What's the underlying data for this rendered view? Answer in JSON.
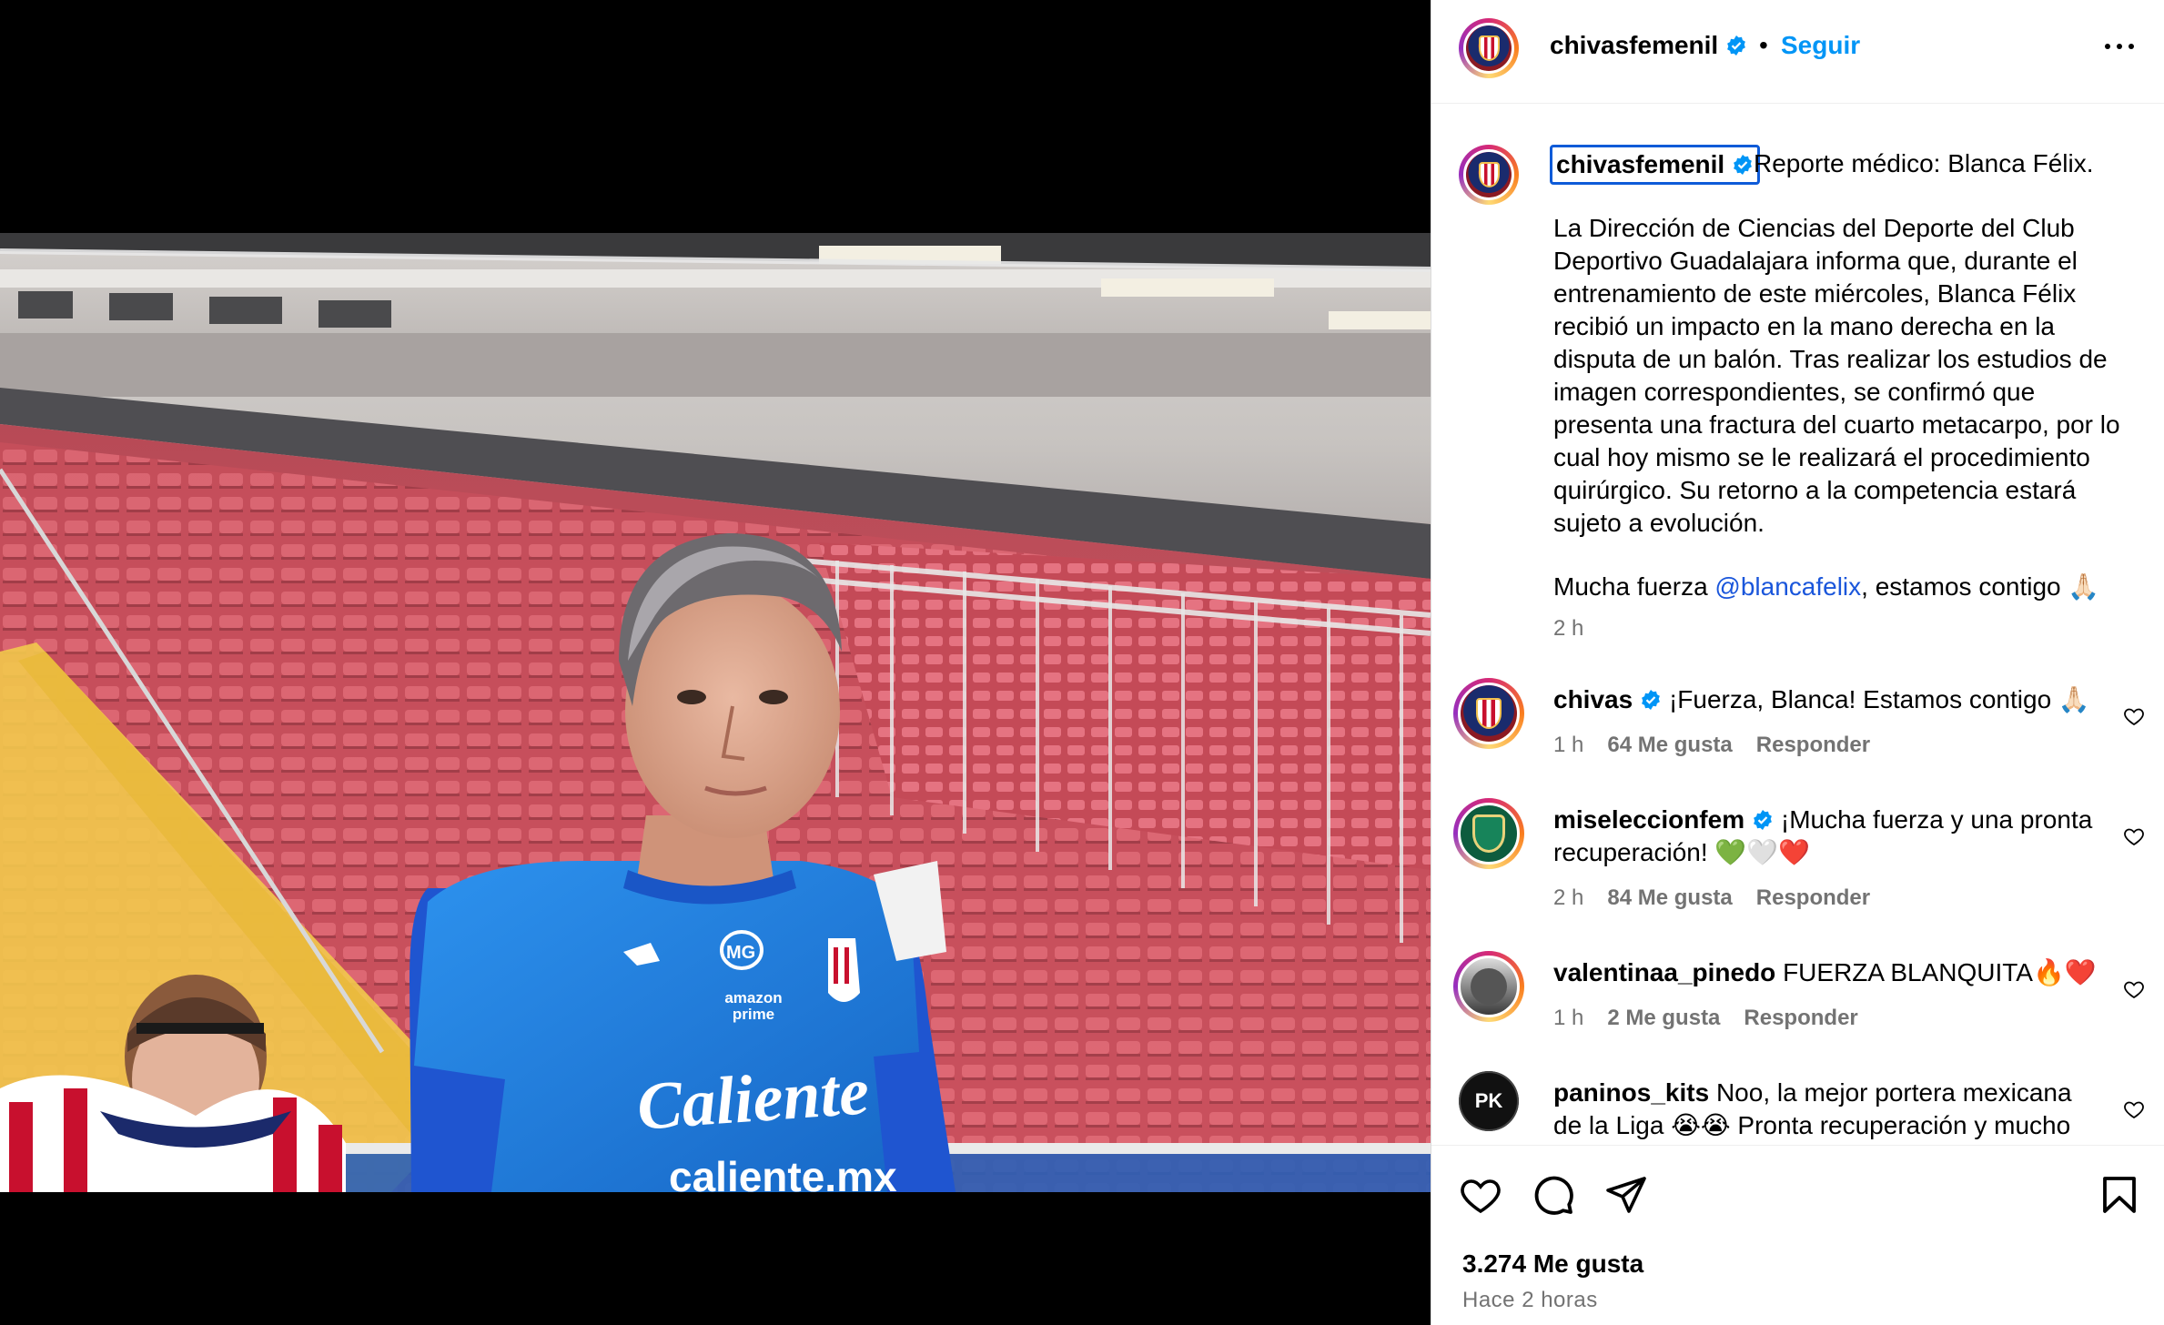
{
  "post": {
    "username": "chivasfemenil",
    "follow_label": "Seguir",
    "separator": "•"
  },
  "caption": {
    "username": "chivasfemenil",
    "title": "Reporte médico: Blanca Félix.",
    "body": "La Dirección de Ciencias del Deporte del Club Deportivo Guadalajara informa que, durante el entrenamiento de este miércoles, Blanca Félix recibió un impacto en la mano derecha en la disputa de un balón. Tras realizar los estudios de imagen correspondientes, se confirmó que presenta una fractura del cuarto metacarpo, por lo cual hoy mismo se le realizará el procedimiento quirúrgico. Su retorno a la competencia estará sujeto a evolución.",
    "closing_prefix": "Mucha fuerza ",
    "closing_mention": "@blancafelix",
    "closing_suffix": ", estamos contigo 🙏🏻",
    "time": "2 h"
  },
  "comments": [
    {
      "username": "chivas",
      "verified": true,
      "text": "¡Fuerza, Blanca! Estamos contigo 🙏🏻",
      "time": "1 h",
      "likes": "64 Me gusta",
      "reply": "Responder"
    },
    {
      "username": "miseleccionfem",
      "verified": true,
      "text": "¡Mucha fuerza y una pronta recuperación! 💚🤍❤️",
      "time": "2 h",
      "likes": "84 Me gusta",
      "reply": "Responder"
    },
    {
      "username": "valentinaa_pinedo",
      "verified": false,
      "text": "FUERZA BLANQUITA🔥❤️",
      "time": "1 h",
      "likes": "2 Me gusta",
      "reply": "Responder"
    },
    {
      "username": "paninos_kits",
      "verified": false,
      "text": "Noo, la mejor portera mexicana de la Liga 😭😭 Pronta recuperación y mucho",
      "time": "",
      "likes": "",
      "reply": ""
    }
  ],
  "footer": {
    "likes": "3.274 Me gusta",
    "time_ago": "Hace 2 horas"
  },
  "photo": {
    "jersey_sponsor": "Caliente",
    "jersey_sponsor_url": "caliente.mx",
    "sleeve_sponsor": "amazon prime",
    "chest_logo": "MG",
    "avatar_badge": "PK"
  },
  "colors": {
    "accent": "#0095f6",
    "mention": "#1a56db",
    "secondary_text": "#737373",
    "jersey": "#1e7fe0",
    "stadium_seats": "#d0525e"
  }
}
